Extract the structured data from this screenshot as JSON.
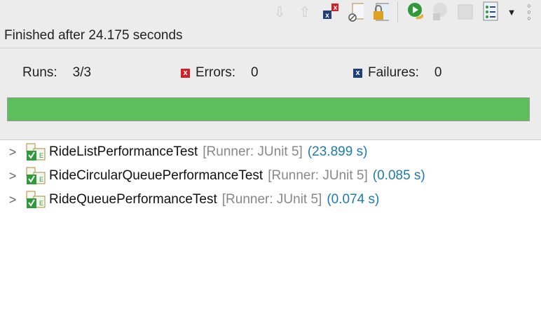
{
  "toolbar": {
    "icons": [
      "next-failure-icon",
      "previous-failure-icon",
      "show-failures-only-icon",
      "show-skipped-icon",
      "scroll-lock-icon",
      "rerun-icon",
      "rerun-failed-first-icon",
      "stop-icon",
      "history-icon",
      "view-menu-icon",
      "more-icon"
    ]
  },
  "status": "Finished after 24.175 seconds",
  "counters": {
    "runs_label": "Runs:",
    "runs": "3/3",
    "errors_label": "Errors:",
    "errors": "0",
    "failures_label": "Failures:",
    "failures": "0"
  },
  "progress": {
    "fraction": 1.0,
    "color": "#5cbf5c"
  },
  "tests": [
    {
      "name": "RideListPerformanceTest",
      "runner": "[Runner: JUnit 5]",
      "time": "(23.899 s)"
    },
    {
      "name": "RideCircularQueuePerformanceTest",
      "runner": "[Runner: JUnit 5]",
      "time": "(0.085 s)"
    },
    {
      "name": "RideQueuePerformanceTest",
      "runner": "[Runner: JUnit 5]",
      "time": "(0.074 s)"
    }
  ]
}
